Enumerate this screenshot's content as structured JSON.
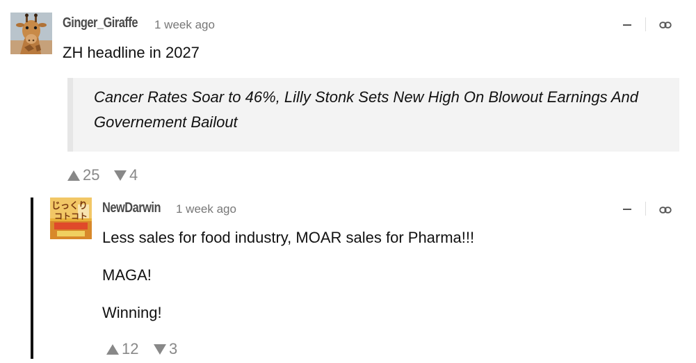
{
  "comment": {
    "author": "Ginger_Giraffe",
    "timestamp": "1 week ago",
    "text": "ZH headline in 2027",
    "quote": "Cancer Rates Soar to 46%, Lilly Stonk Sets New High On Blowout Earnings And Governement Bailout",
    "upvotes": "25",
    "downvotes": "4"
  },
  "reply": {
    "author": "NewDarwin",
    "timestamp": "1 week ago",
    "paragraphs": [
      "Less sales for food industry, MOAR sales for Pharma!!!",
      "MAGA!",
      "Winning!"
    ],
    "avatar_text": "じっくり コトコト",
    "upvotes": "12",
    "downvotes": "3"
  },
  "icons": {
    "collapse": "minus-icon",
    "permalink": "link-icon",
    "upvote": "triangle-up-icon",
    "downvote": "triangle-down-icon"
  },
  "colors": {
    "vote_gray": "#888888",
    "author_gray": "#4a4a4a",
    "quote_bg": "#f3f3f3",
    "thread_bar": "#111111"
  }
}
